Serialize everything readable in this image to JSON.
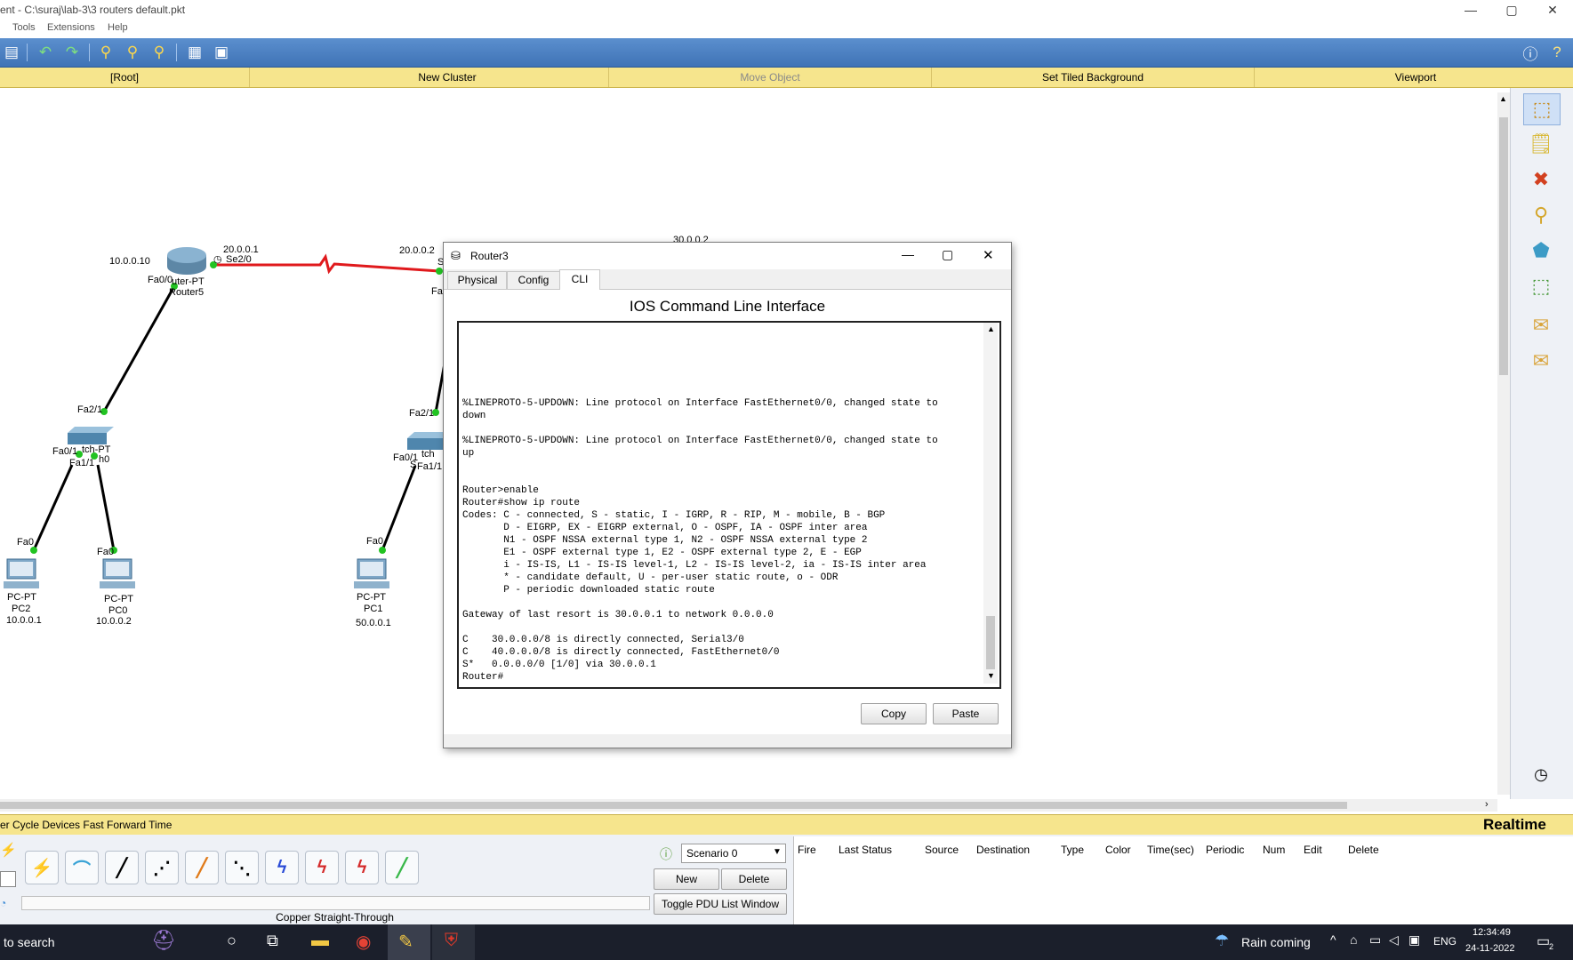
{
  "window": {
    "title": "ent - C:\\suraj\\lab-3\\3 routers default.pkt",
    "min": "—",
    "max": "▢",
    "close": "✕"
  },
  "menu": [
    "Tools",
    "Extensions",
    "Help"
  ],
  "cluster_bar": [
    "[Root]",
    "New Cluster",
    "Move Object",
    "Set Tiled Background",
    "Viewport"
  ],
  "topology": {
    "router5": {
      "type": "Router-PT",
      "name": "Router5",
      "ip": "10.0.0.10",
      "serial_ip": "20.0.0.1",
      "serial_port": "Se2/0",
      "fa_port": "Fa0/0",
      "display_type": "uter-PT"
    },
    "router_mid": {
      "ip_left": "20.0.0.2",
      "ip_right": "30.0.0.2",
      "port": "S",
      "port2": "Fa0"
    },
    "switch_left": {
      "label": "tch-PT",
      "label2": "h0",
      "ports": [
        "Fa2/1",
        "Fa0/1",
        "Fa1/1"
      ]
    },
    "switch_right": {
      "label": "tch",
      "ports": [
        "Fa2/1",
        "Fa0/1",
        "Fa1/1"
      ],
      "extra": "S"
    },
    "pcs": [
      {
        "type": "PC-PT",
        "name": "PC2",
        "ip": "10.0.0.1",
        "port": "Fa0"
      },
      {
        "type": "PC-PT",
        "name": "PC0",
        "ip": "10.0.0.2",
        "port": "Fa0"
      },
      {
        "type": "PC-PT",
        "name": "PC1",
        "ip": "50.0.0.1",
        "port": "Fa0"
      }
    ]
  },
  "dialog": {
    "title": "Router3",
    "tabs": [
      "Physical",
      "Config",
      "CLI"
    ],
    "active_tab": "CLI",
    "heading": "IOS Command Line Interface",
    "cli_lines": [
      "%LINEPROTO-5-UPDOWN: Line protocol on Interface FastEthernet0/0, changed state to",
      "down",
      "",
      "%LINEPROTO-5-UPDOWN: Line protocol on Interface FastEthernet0/0, changed state to",
      "up",
      "",
      "",
      "Router>enable",
      "Router#show ip route",
      "Codes: C - connected, S - static, I - IGRP, R - RIP, M - mobile, B - BGP",
      "       D - EIGRP, EX - EIGRP external, O - OSPF, IA - OSPF inter area",
      "       N1 - OSPF NSSA external type 1, N2 - OSPF NSSA external type 2",
      "       E1 - OSPF external type 1, E2 - OSPF external type 2, E - EGP",
      "       i - IS-IS, L1 - IS-IS level-1, L2 - IS-IS level-2, ia - IS-IS inter area",
      "       * - candidate default, U - per-user static route, o - ODR",
      "       P - periodic downloaded static route",
      "",
      "Gateway of last resort is 30.0.0.1 to network 0.0.0.0",
      "",
      "C    30.0.0.0/8 is directly connected, Serial3/0",
      "C    40.0.0.0/8 is directly connected, FastEthernet0/0",
      "S*   0.0.0.0/0 [1/0] via 30.0.0.1",
      "Router#"
    ],
    "copy_label": "Copy",
    "paste_label": "Paste"
  },
  "bottom_bar": {
    "left_text": "er Cycle Devices  Fast Forward Time",
    "mode": "Realtime"
  },
  "connections": {
    "selected_label": "Copper Straight-Through"
  },
  "scenario": {
    "selected": "Scenario 0",
    "new_label": "New",
    "delete_label": "Delete",
    "toggle_label": "Toggle PDU List Window"
  },
  "pdu_columns": [
    "Fire",
    "Last Status",
    "Source",
    "Destination",
    "Type",
    "Color",
    "Time(sec)",
    "Periodic",
    "Num",
    "Edit",
    "Delete"
  ],
  "taskbar": {
    "search": "to search",
    "weather": "Rain coming",
    "lang": "ENG",
    "time": "12:34:49",
    "date": "24-11-2022",
    "notif": "2"
  },
  "colors": {
    "toolbar": "#3f73b6",
    "cluster_bar": "#f6e58d",
    "serial_link": "#e0191c",
    "link_up": "#22c322"
  }
}
